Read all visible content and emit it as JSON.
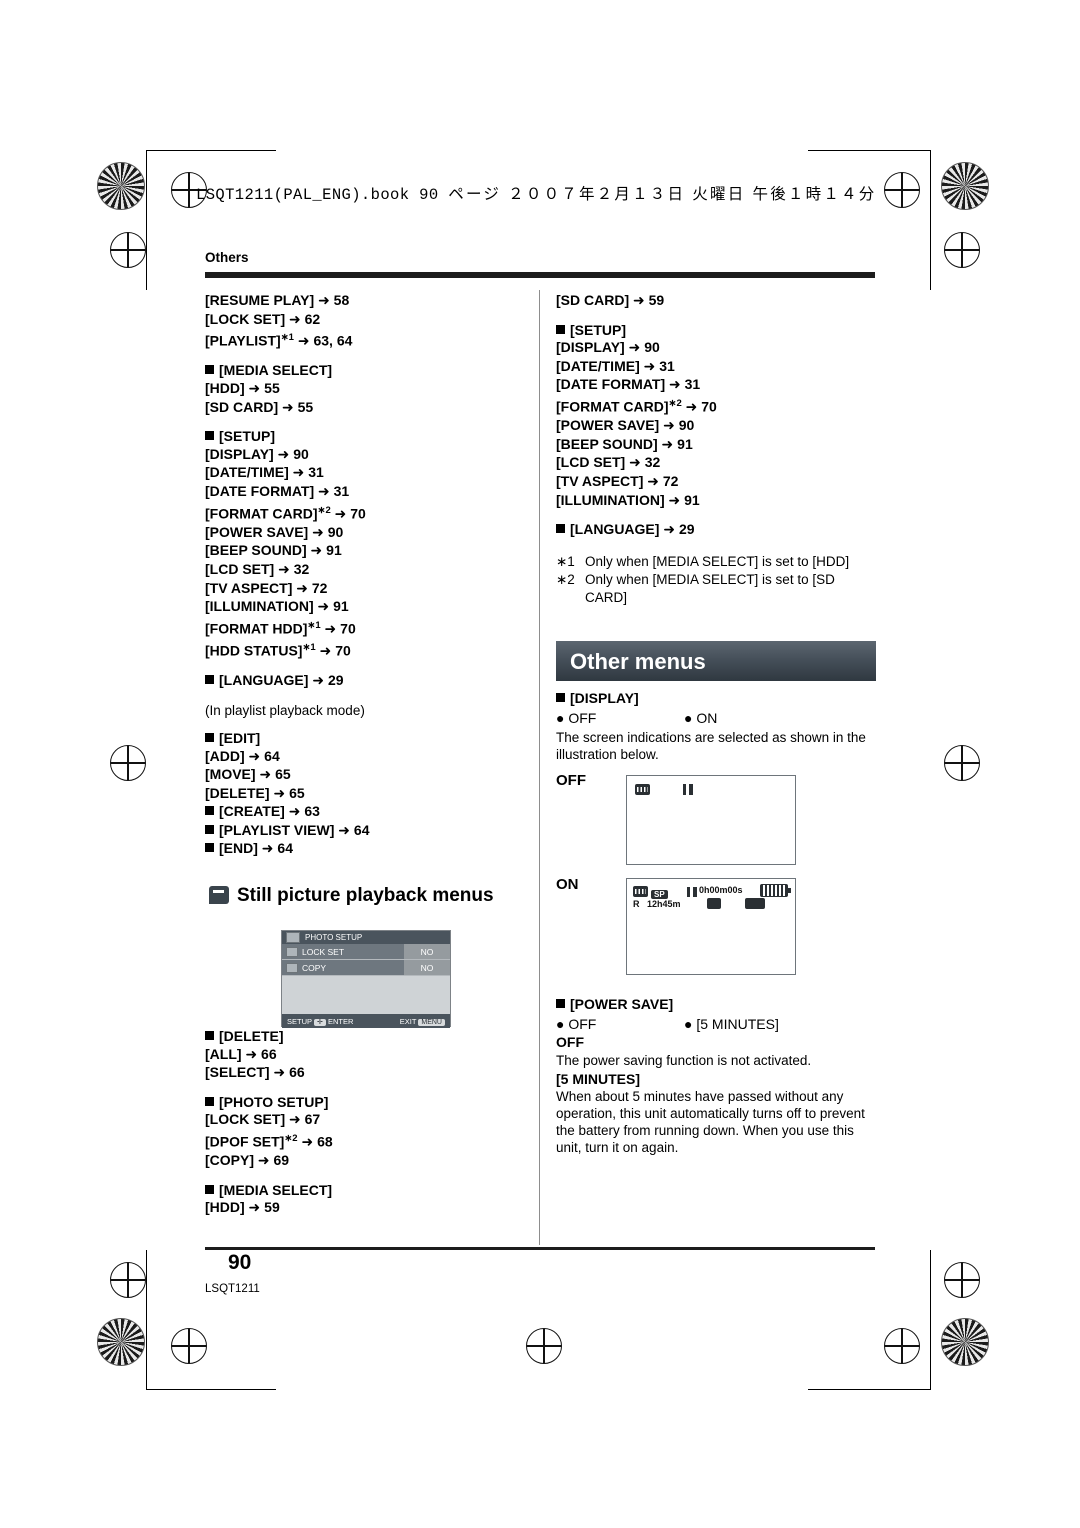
{
  "header": {
    "file_line_mono": "LSQT1211(PAL_ENG).book   90 ",
    "file_line_jp": "ページ  ２００７年２月１３日  火曜日  午後１時１４分",
    "section_label": "Others"
  },
  "footer": {
    "page_number": "90",
    "doc_code": "LSQT1211"
  },
  "left_column": {
    "groups": [
      {
        "items": [
          {
            "text": "[RESUME PLAY] (",
            "page": "58",
            "indent": false,
            "bullet": false
          },
          {
            "text": "[LOCK SET] (",
            "page": "62",
            "indent": false,
            "bullet": false
          },
          {
            "text": "[PLAYLIST]*1 (",
            "page": "63, 64",
            "indent": false,
            "bullet": false
          }
        ]
      },
      {
        "items": [
          {
            "text": "[MEDIA SELECT]",
            "page": "",
            "indent": false,
            "bullet": true
          },
          {
            "text": "[HDD] (",
            "page": "55",
            "indent": false,
            "bullet": false
          },
          {
            "text": "[SD CARD] (",
            "page": "55",
            "indent": false,
            "bullet": false
          }
        ]
      },
      {
        "items": [
          {
            "text": "[SETUP]",
            "page": "",
            "indent": false,
            "bullet": true
          },
          {
            "text": "[DISPLAY] (",
            "page": "90",
            "indent": false,
            "bullet": false
          },
          {
            "text": "[DATE/TIME] (",
            "page": "31",
            "indent": false,
            "bullet": false
          },
          {
            "text": "[DATE FORMAT] (",
            "page": "31",
            "indent": false,
            "bullet": false
          },
          {
            "text": "[FORMAT CARD]*2 (",
            "page": "70",
            "indent": false,
            "bullet": false
          },
          {
            "text": "[POWER SAVE] (",
            "page": "90",
            "indent": false,
            "bullet": false
          },
          {
            "text": "[BEEP SOUND] (",
            "page": "91",
            "indent": false,
            "bullet": false
          },
          {
            "text": "[LCD SET] (",
            "page": "32",
            "indent": false,
            "bullet": false
          },
          {
            "text": "[TV ASPECT] (",
            "page": "72",
            "indent": false,
            "bullet": false
          },
          {
            "text": "[ILLUMINATION] (",
            "page": "91",
            "indent": false,
            "bullet": false
          },
          {
            "text": "[FORMAT HDD]*1 (",
            "page": "70",
            "indent": false,
            "bullet": false
          },
          {
            "text": "[HDD STATUS]*1 (",
            "page": "70",
            "indent": false,
            "bullet": false
          }
        ]
      },
      {
        "items": [
          {
            "text": "[LANGUAGE] (",
            "page": "29",
            "indent": false,
            "bullet": true
          }
        ]
      }
    ],
    "playlist_note": "(In playlist playback mode)",
    "groups2": [
      {
        "items": [
          {
            "text": "[EDIT]",
            "page": "",
            "indent": false,
            "bullet": true
          },
          {
            "text": "[ADD] (",
            "page": "64",
            "indent": false,
            "bullet": false
          },
          {
            "text": "[MOVE] (",
            "page": "65",
            "indent": false,
            "bullet": false
          },
          {
            "text": "[DELETE] (",
            "page": "65",
            "indent": false,
            "bullet": false
          },
          {
            "text": "[CREATE] (",
            "page": "63",
            "indent": false,
            "bullet": true
          },
          {
            "text": "[PLAYLIST VIEW] (",
            "page": "64",
            "indent": false,
            "bullet": true
          },
          {
            "text": "[END] (",
            "page": "64",
            "indent": false,
            "bullet": true
          }
        ]
      }
    ],
    "subheading": "Still picture playback menus",
    "groups3": [
      {
        "items": [
          {
            "text": "[DELETE]",
            "page": "",
            "indent": false,
            "bullet": true
          },
          {
            "text": "[ALL] (",
            "page": "66",
            "indent": false,
            "bullet": false
          },
          {
            "text": "[SELECT] (",
            "page": "66",
            "indent": false,
            "bullet": false
          }
        ]
      },
      {
        "items": [
          {
            "text": "[PHOTO SETUP]",
            "page": "",
            "indent": false,
            "bullet": true
          },
          {
            "text": "[LOCK SET] (",
            "page": "67",
            "indent": false,
            "bullet": false
          },
          {
            "text": "[DPOF SET]*2 (",
            "page": "68",
            "indent": false,
            "bullet": false
          },
          {
            "text": "[COPY] (",
            "page": "69",
            "indent": false,
            "bullet": false
          }
        ]
      },
      {
        "items": [
          {
            "text": "[MEDIA SELECT]",
            "page": "",
            "indent": false,
            "bullet": true
          },
          {
            "text": "[HDD] (",
            "page": "59",
            "indent": false,
            "bullet": false
          }
        ]
      }
    ]
  },
  "right_column": {
    "groups": [
      {
        "items": [
          {
            "text": "[SD CARD] (",
            "page": "59",
            "indent": false,
            "bullet": false
          }
        ]
      },
      {
        "items": [
          {
            "text": "[SETUP]",
            "page": "",
            "indent": false,
            "bullet": true
          },
          {
            "text": "[DISPLAY] (",
            "page": "90",
            "indent": false,
            "bullet": false
          },
          {
            "text": "[DATE/TIME] (",
            "page": "31",
            "indent": false,
            "bullet": false
          },
          {
            "text": "[DATE FORMAT] (",
            "page": "31",
            "indent": false,
            "bullet": false
          },
          {
            "text": "[FORMAT CARD]*2 (",
            "page": "70",
            "indent": false,
            "bullet": false
          },
          {
            "text": "[POWER SAVE] (",
            "page": "90",
            "indent": false,
            "bullet": false
          },
          {
            "text": "[BEEP SOUND] (",
            "page": "91",
            "indent": false,
            "bullet": false
          },
          {
            "text": "[LCD SET] (",
            "page": "32",
            "indent": false,
            "bullet": false
          },
          {
            "text": "[TV ASPECT] (",
            "page": "72",
            "indent": false,
            "bullet": false
          },
          {
            "text": "[ILLUMINATION] (",
            "page": "91",
            "indent": false,
            "bullet": false
          }
        ]
      },
      {
        "items": [
          {
            "text": "[LANGUAGE] (",
            "page": "29",
            "indent": false,
            "bullet": true
          }
        ]
      }
    ],
    "footnotes": [
      {
        "mark": "*1",
        "text": "Only when [MEDIA SELECT] is set to [HDD]"
      },
      {
        "mark": "*2",
        "text": "Only when [MEDIA SELECT] is set to [SD CARD]"
      }
    ],
    "band_title": "Other menus",
    "display_section": {
      "heading": "[DISPLAY]",
      "option_off": "OFF",
      "option_on": "ON",
      "description": "The screen indications are selected as shown in the illustration below.",
      "label_off": "OFF",
      "label_on": "ON"
    },
    "power_save_section": {
      "heading": "[POWER SAVE]",
      "option_off": "OFF",
      "option_5min": "5 MINUTES",
      "off_title": "OFF",
      "off_text": "The power saving function is not activated.",
      "min_title": "[5 MINUTES]",
      "min_text": "When about 5 minutes have passed without any operation, this unit automatically turns off to prevent the battery from running down. When you use this unit, turn it on again."
    }
  },
  "osd_photo_menu": {
    "title": "PHOTO SETUP",
    "rows": [
      {
        "label": "LOCK SET",
        "value": "NO"
      },
      {
        "label": "COPY",
        "value": "NO"
      }
    ],
    "footer_left": "SETUP",
    "footer_left2": "ENTER",
    "footer_right": "EXIT",
    "footer_right_key": "MENU"
  },
  "osd_on_screen": {
    "mode": "SP",
    "time": "0h00m00s",
    "remain_label": "R",
    "remain_value": "12h45m"
  }
}
